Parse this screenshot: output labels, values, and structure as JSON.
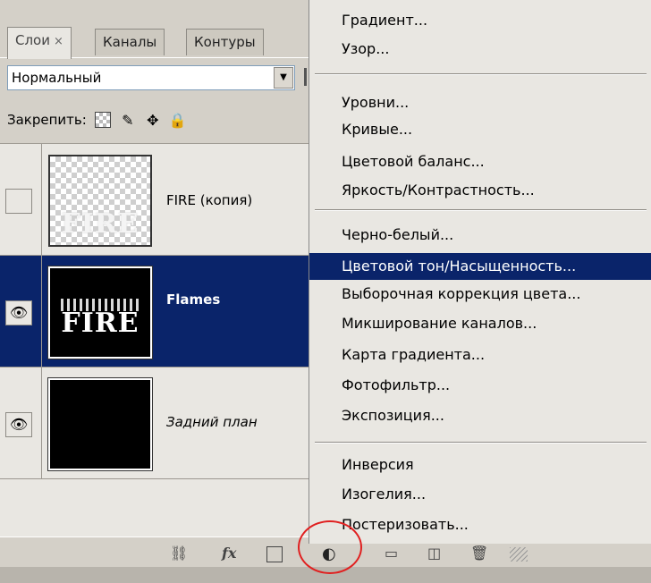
{
  "tabs": [
    {
      "label": "Слои",
      "close": "×"
    },
    {
      "label": "Каналы"
    },
    {
      "label": "Контуры"
    }
  ],
  "blend_mode": {
    "value": "Нормальный"
  },
  "lock": {
    "label": "Закрепить:",
    "icons": [
      "lock-transparency-icon",
      "lock-paint-icon",
      "lock-position-icon",
      "lock-all-icon"
    ]
  },
  "layers": [
    {
      "name": "FIRE (копия)",
      "visible": false,
      "thumb_text": "FIRE"
    },
    {
      "name": "Flames",
      "visible": true,
      "selected": true,
      "thumb_text": "FIRE"
    },
    {
      "name": "Задний план",
      "visible": true
    }
  ],
  "toolbar": {
    "icons": [
      "link-icon",
      "fx-icon",
      "mask-icon",
      "adjustment-layer-icon",
      "group-folder-icon",
      "new-layer-icon",
      "trash-icon"
    ],
    "fx_label": "fx"
  },
  "menu": {
    "items": [
      "Градиент...",
      "Узор...",
      "Уровни...",
      "Кривые...",
      "Цветовой баланс...",
      "Яркость/Контрастность...",
      "Черно-белый...",
      "Цветовой тон/Насыщенность...",
      "Выборочная коррекция цвета...",
      "Микширование каналов...",
      "Карта градиента...",
      "Фотофильтр...",
      "Экспозиция...",
      "Инверсия",
      "Изогелия...",
      "Постеризовать..."
    ],
    "highlighted": "Цветовой тон/Насыщенность..."
  },
  "colors": {
    "selection": "#0a246a",
    "panel": "#d4d0c8",
    "annotation": "#e02020"
  }
}
